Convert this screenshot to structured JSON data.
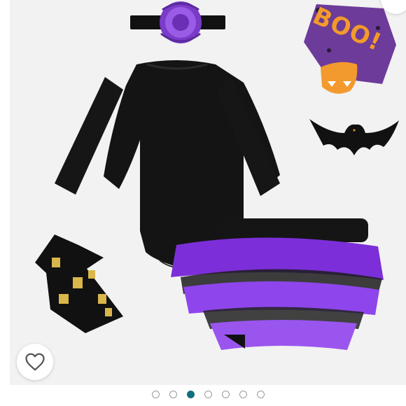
{
  "product": {
    "boo_text": "BOO!"
  },
  "carousel": {
    "total_images": 7,
    "active_index": 3
  },
  "colors": {
    "accent": "#126f7c",
    "garment_black": "#141414",
    "tulle_purple": "#8a3fe0",
    "background": "#f2f2f2"
  },
  "icons": {
    "favorite": "heart-outline-icon"
  }
}
